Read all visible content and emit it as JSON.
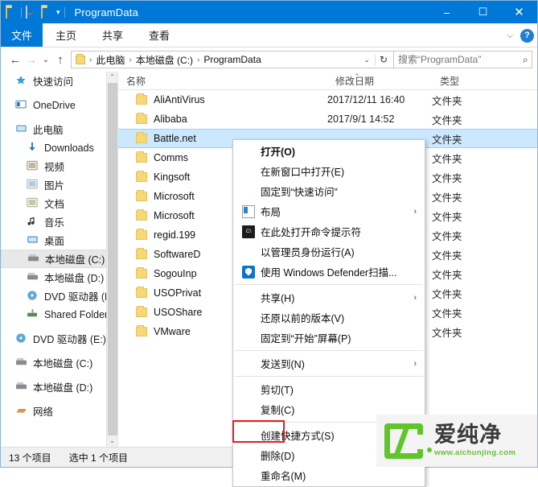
{
  "titlebar": {
    "title": "ProgramData",
    "quick_access_icons": [
      "folder-icon",
      "properties-icon",
      "new-folder-icon",
      "chevron-down-icon"
    ],
    "minimize": "–",
    "maximize": "☐",
    "close": "✕"
  },
  "ribbon": {
    "file_tab": "文件",
    "tabs": [
      "主页",
      "共享",
      "查看"
    ],
    "expand": "⌵",
    "help": "?"
  },
  "addressbar": {
    "back": "←",
    "forward": "→",
    "recent": "⌄",
    "up": "↑",
    "breadcrumbs": [
      "此电脑",
      "本地磁盘 (C:)",
      "ProgramData"
    ],
    "separator": "›",
    "dropdown": "⌄",
    "refresh": "↻",
    "search_placeholder": "搜索“ProgramData”",
    "search_value": "",
    "search_icon": "⌕"
  },
  "sidebar": {
    "items": [
      {
        "label": "快速访问",
        "icon": "star-icon",
        "level": 1,
        "selected": false
      },
      {
        "label": "OneDrive",
        "icon": "onedrive-icon",
        "level": 1,
        "selected": false
      },
      {
        "label": "此电脑",
        "icon": "computer-icon",
        "level": 1,
        "selected": false
      },
      {
        "label": "Downloads",
        "icon": "download-icon",
        "level": 2,
        "selected": false
      },
      {
        "label": "视频",
        "icon": "video-icon",
        "level": 2,
        "selected": false
      },
      {
        "label": "图片",
        "icon": "pictures-icon",
        "level": 2,
        "selected": false
      },
      {
        "label": "文档",
        "icon": "documents-icon",
        "level": 2,
        "selected": false
      },
      {
        "label": "音乐",
        "icon": "music-icon",
        "level": 2,
        "selected": false
      },
      {
        "label": "桌面",
        "icon": "desktop-icon",
        "level": 2,
        "selected": false
      },
      {
        "label": "本地磁盘 (C:)",
        "icon": "drive-icon",
        "level": 2,
        "selected": true
      },
      {
        "label": "本地磁盘 (D:)",
        "icon": "drive-icon",
        "level": 2,
        "selected": false
      },
      {
        "label": "DVD 驱动器 (E:)",
        "icon": "dvd-icon",
        "level": 2,
        "selected": false
      },
      {
        "label": "Shared Folders",
        "icon": "network-drive-icon",
        "level": 2,
        "selected": false
      },
      {
        "label": "DVD 驱动器 (E:) C",
        "icon": "dvd-icon",
        "level": 1,
        "selected": false
      },
      {
        "label": "本地磁盘 (C:)",
        "icon": "drive-icon",
        "level": 1,
        "selected": false
      },
      {
        "label": "本地磁盘 (D:)",
        "icon": "drive-icon",
        "level": 1,
        "selected": false
      },
      {
        "label": "网络",
        "icon": "network-icon",
        "level": 1,
        "selected": false
      }
    ],
    "scroll_up": "⌃",
    "scroll_down": "⌄"
  },
  "filelist": {
    "columns": [
      "名称",
      "修改日期",
      "类型"
    ],
    "sort_indicator": "⌃",
    "rows": [
      {
        "name": "AliAntiVirus",
        "date": "2017/12/11 16:40",
        "type": "文件夹",
        "selected": false
      },
      {
        "name": "Alibaba",
        "date": "2017/9/1 14:52",
        "type": "文件夹",
        "selected": false
      },
      {
        "name": "Battle.net",
        "date": "",
        "type": "文件夹",
        "selected": true
      },
      {
        "name": "Comms",
        "date": "",
        "type": "文件夹",
        "selected": false
      },
      {
        "name": "Kingsoft",
        "date": "",
        "type": "文件夹",
        "selected": false
      },
      {
        "name": "Microsoft",
        "date": "",
        "type": "文件夹",
        "selected": false
      },
      {
        "name": "Microsoft",
        "date": "",
        "type": "文件夹",
        "selected": false
      },
      {
        "name": "regid.199",
        "date": "",
        "type": "文件夹",
        "selected": false
      },
      {
        "name": "SoftwareD",
        "date": "",
        "type": "文件夹",
        "selected": false
      },
      {
        "name": "SogouInp",
        "date": "",
        "type": "文件夹",
        "selected": false
      },
      {
        "name": "USOPrivat",
        "date": "",
        "type": "文件夹",
        "selected": false
      },
      {
        "name": "USOShare",
        "date": "",
        "type": "文件夹",
        "selected": false
      },
      {
        "name": "VMware",
        "date": "",
        "type": "文件夹",
        "selected": false
      }
    ]
  },
  "context_menu": {
    "items": [
      {
        "label": "打开(O)",
        "bold": true,
        "submenu": false,
        "icon": null,
        "sep_after": false
      },
      {
        "label": "在新窗口中打开(E)",
        "bold": false,
        "submenu": false,
        "icon": null,
        "sep_after": false
      },
      {
        "label": "固定到“快速访问”",
        "bold": false,
        "submenu": false,
        "icon": null,
        "sep_after": false
      },
      {
        "label": "布局",
        "bold": false,
        "submenu": true,
        "icon": "layout-icon",
        "sep_after": false
      },
      {
        "label": "在此处打开命令提示符",
        "bold": false,
        "submenu": false,
        "icon": "cmd-icon",
        "sep_after": false
      },
      {
        "label": "以管理员身份运行(A)",
        "bold": false,
        "submenu": false,
        "icon": null,
        "sep_after": false
      },
      {
        "label": "使用 Windows Defender扫描...",
        "bold": false,
        "submenu": false,
        "icon": "defender-icon",
        "sep_after": true
      },
      {
        "label": "共享(H)",
        "bold": false,
        "submenu": true,
        "icon": null,
        "sep_after": false
      },
      {
        "label": "还原以前的版本(V)",
        "bold": false,
        "submenu": false,
        "icon": null,
        "sep_after": false
      },
      {
        "label": "固定到“开始”屏幕(P)",
        "bold": false,
        "submenu": false,
        "icon": null,
        "sep_after": true
      },
      {
        "label": "发送到(N)",
        "bold": false,
        "submenu": true,
        "icon": null,
        "sep_after": true
      },
      {
        "label": "剪切(T)",
        "bold": false,
        "submenu": false,
        "icon": null,
        "sep_after": false
      },
      {
        "label": "复制(C)",
        "bold": false,
        "submenu": false,
        "icon": null,
        "sep_after": true
      },
      {
        "label": "创建快捷方式(S)",
        "bold": false,
        "submenu": false,
        "icon": null,
        "sep_after": false
      },
      {
        "label": "删除(D)",
        "bold": false,
        "submenu": false,
        "icon": null,
        "sep_after": false,
        "highlighted": true
      },
      {
        "label": "重命名(M)",
        "bold": false,
        "submenu": false,
        "icon": null,
        "sep_after": false
      }
    ],
    "submenu_arrow": "›",
    "highlight_color": "#e32020"
  },
  "statusbar": {
    "item_count": "13 个项目",
    "selected_count": "选中 1 个项目"
  },
  "watermark": {
    "brand": "爱纯净",
    "url": "www.aichunjing.com",
    "color": "#5fc52b"
  }
}
